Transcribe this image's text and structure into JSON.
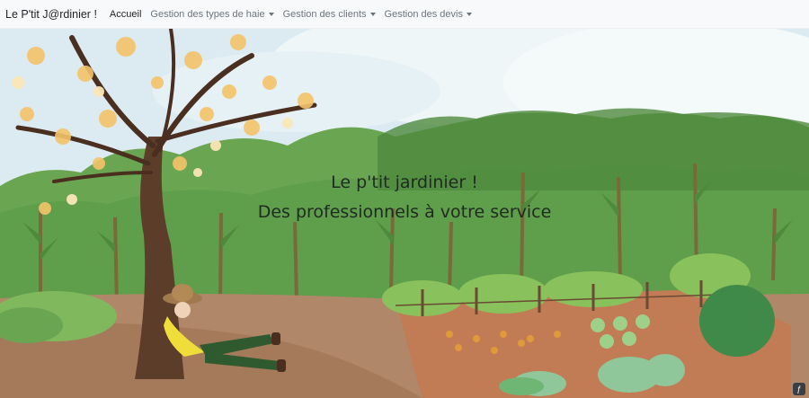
{
  "navbar": {
    "brand": "Le P'tit J@rdinier !",
    "items": [
      {
        "label": "Accueil",
        "active": true,
        "dropdown": false
      },
      {
        "label": "Gestion des types de haie",
        "active": false,
        "dropdown": true
      },
      {
        "label": "Gestion des clients",
        "active": false,
        "dropdown": true
      },
      {
        "label": "Gestion des devis",
        "active": false,
        "dropdown": true
      }
    ]
  },
  "hero": {
    "title": "Le p'tit jardinier !",
    "subtitle": "Des professionnels à votre service"
  },
  "colors": {
    "navbar_bg": "#f8f9fa",
    "sky": "#dcebf2",
    "foliage": "#5f9e4a",
    "ground": "#a57a5a",
    "hero_text": "#1f2a22"
  },
  "icons": {
    "dropdown": "caret-down-icon",
    "corner": "symfony-toolbar-icon"
  }
}
